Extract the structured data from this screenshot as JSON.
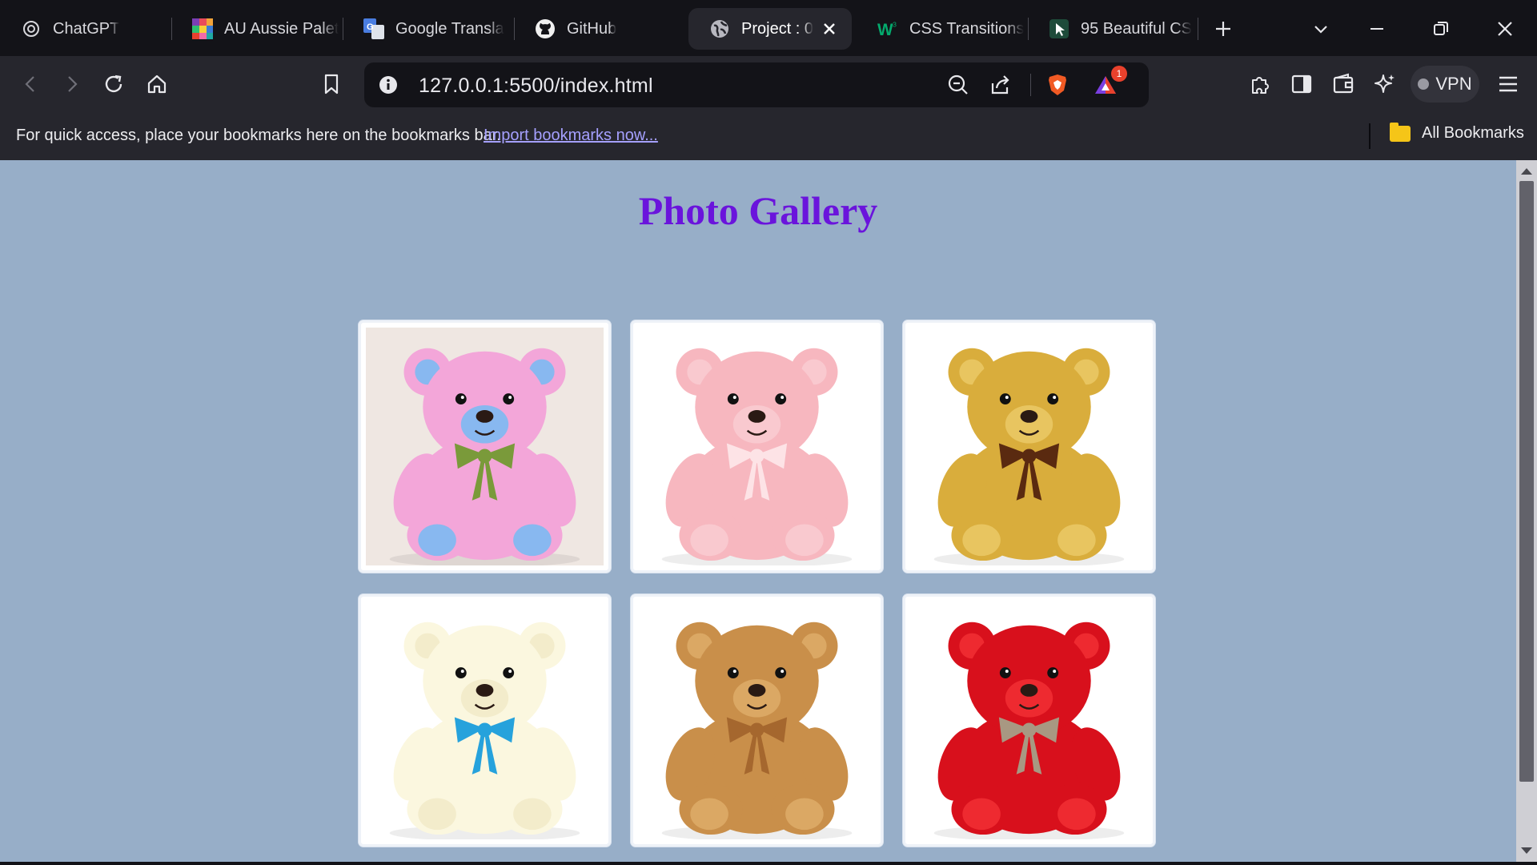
{
  "tabs": [
    {
      "title": "ChatGPT",
      "icon": "chatgpt-icon"
    },
    {
      "title": "AU Aussie Palet",
      "icon": "palette-icon"
    },
    {
      "title": "Google Transla",
      "icon": "google-translate-icon"
    },
    {
      "title": "GitHub",
      "icon": "github-icon"
    },
    {
      "title": "Project : 0",
      "icon": "globe-icon",
      "active": true
    },
    {
      "title": "CSS Transitions",
      "icon": "w3schools-icon"
    },
    {
      "title": "95 Beautiful CS",
      "icon": "cursor-icon"
    }
  ],
  "address_bar": {
    "url": "127.0.0.1:5500/index.html",
    "notification_count": "1"
  },
  "vpn_label": "VPN",
  "bookmarks_bar": {
    "message": "For quick access, place your bookmarks here on the bookmarks bar.",
    "import_link": "Import bookmarks now...",
    "all_bookmarks": "All Bookmarks"
  },
  "page": {
    "heading": "Photo Gallery",
    "background": "#97aec8",
    "heading_color": "#6a14dc"
  },
  "gallery": [
    {
      "name": "rainbow-teddy-bear",
      "fur": "#f3a6d9",
      "accent": "#88b8f0",
      "ribbon": "#7a9a3a",
      "bg": "#efe7e2"
    },
    {
      "name": "pink-teddy-bear",
      "fur": "#f7b7bf",
      "accent": "#f9c9cf",
      "ribbon": "#fde3e6",
      "bg": "#ffffff"
    },
    {
      "name": "golden-teddy-bear",
      "fur": "#d9ad3c",
      "accent": "#e8c560",
      "ribbon": "#5a2a10",
      "bg": "#ffffff"
    },
    {
      "name": "cream-teddy-bear",
      "fur": "#fbf7df",
      "accent": "#f3eccb",
      "ribbon": "#26a2dc",
      "bg": "#ffffff"
    },
    {
      "name": "brown-teddy-bear",
      "fur": "#c98f4a",
      "accent": "#dba864",
      "ribbon": "#a5672e",
      "bg": "#ffffff"
    },
    {
      "name": "red-teddy-bear",
      "fur": "#d8101c",
      "accent": "#ee2a30",
      "ribbon": "#a89882",
      "bg": "#ffffff"
    }
  ]
}
